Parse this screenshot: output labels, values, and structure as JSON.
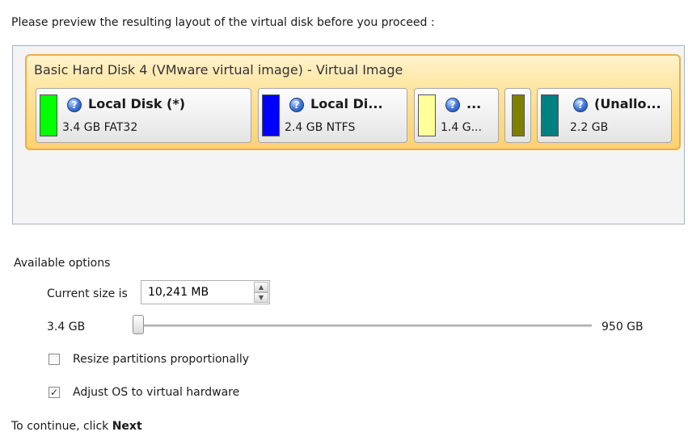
{
  "intro_text": "Please preview the resulting layout of the virtual disk before you proceed :",
  "disk": {
    "title": "Basic Hard Disk 4 (VMware virtual image) - Virtual Image",
    "partitions": [
      {
        "name": "Local Disk (*)",
        "size": "3.4 GB FAT32",
        "color": "#00ff00",
        "icon": "help-icon"
      },
      {
        "name": "Local Di...",
        "size": "2.4 GB NTFS",
        "color": "#0000ff",
        "icon": "help-icon"
      },
      {
        "name": "...",
        "size": "1.4 G...",
        "color": "#ffff99",
        "icon": "help-icon"
      },
      {
        "name": "",
        "size": "",
        "color": "#808000",
        "icon": ""
      },
      {
        "name": "(Unallo...",
        "size": "2.2 GB",
        "color": "#008080",
        "icon": "help-icon"
      }
    ]
  },
  "options": {
    "label": "Available options",
    "current_size_label": "Current size is",
    "current_size_value": "10,241 MB",
    "slider_min_label": "3.4 GB",
    "slider_max_label": "950 GB",
    "slider_position": 0.0,
    "resize_label": "Resize partitions proportionally",
    "resize_checked": false,
    "adjust_os_label": "Adjust OS to virtual hardware",
    "adjust_os_checked": true
  },
  "footer": {
    "prefix": "To continue, click",
    "action": "Next"
  }
}
